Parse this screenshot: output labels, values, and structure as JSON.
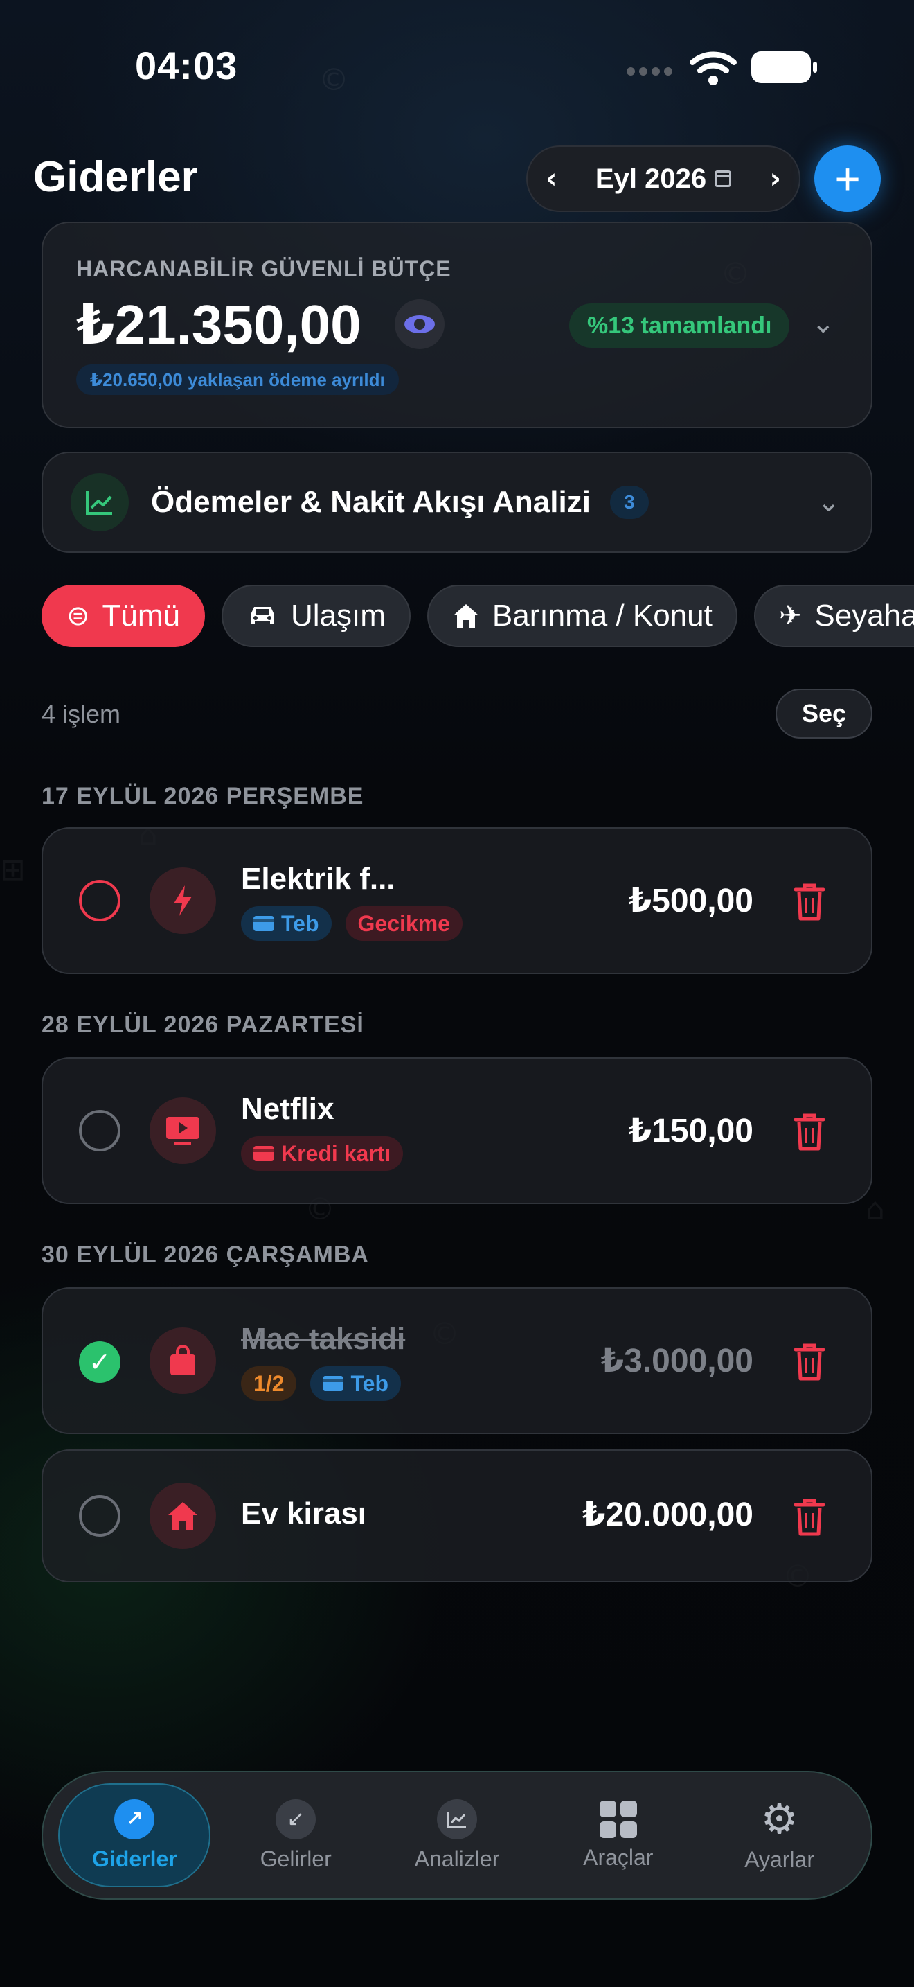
{
  "status_bar": {
    "time": "04:03"
  },
  "header": {
    "title": "Giderler",
    "month": "Eyl 2026",
    "add_label": "+"
  },
  "budget": {
    "label": "HARCANABİLİR GÜVENLİ BÜTÇE",
    "amount": "₺21.350,00",
    "progress_text": "%13 tamamlandı",
    "reserved_text": "₺20.650,00 yaklaşan ödeme ayrıldı"
  },
  "analysis": {
    "title": "Ödemeler & Nakit Akışı Analizi",
    "count": "3"
  },
  "filters": [
    {
      "label": "Tümü",
      "icon": "filter-icon",
      "active": true
    },
    {
      "label": "Ulaşım",
      "icon": "car-icon",
      "active": false
    },
    {
      "label": "Barınma / Konut",
      "icon": "home-icon",
      "active": false
    },
    {
      "label": "Seyahat",
      "icon": "airplane-icon",
      "active": false
    }
  ],
  "list": {
    "count_text": "4 işlem",
    "select_label": "Seç"
  },
  "groups": [
    {
      "date": "17 EYLÜL 2026 PERŞEMBE"
    },
    {
      "date": "28 EYLÜL 2026 PAZARTESİ"
    },
    {
      "date": "30 EYLÜL 2026 ÇARŞAMBA"
    }
  ],
  "transactions": [
    {
      "title": "Elektrik f...",
      "amount": "₺500,00",
      "tags": [
        "Teb",
        "Gecikme"
      ],
      "status": "overdue"
    },
    {
      "title": "Netflix",
      "amount": "₺150,00",
      "tags": [
        "Kredi kartı"
      ],
      "status": "unpaid"
    },
    {
      "title": "Mac taksidi",
      "amount": "₺3.000,00",
      "tags": [
        "1/2",
        "Teb"
      ],
      "status": "paid"
    },
    {
      "title": "Ev kirası",
      "amount": "₺20.000,00",
      "tags": [],
      "status": "unpaid"
    }
  ],
  "nav": [
    {
      "label": "Giderler",
      "active": true
    },
    {
      "label": "Gelirler",
      "active": false
    },
    {
      "label": "Analizler",
      "active": false
    },
    {
      "label": "Araçlar",
      "active": false
    },
    {
      "label": "Ayarlar",
      "active": false
    }
  ],
  "colors": {
    "accent_red": "#f0394e",
    "accent_blue": "#1e8ff0",
    "accent_green": "#2bc26d"
  }
}
